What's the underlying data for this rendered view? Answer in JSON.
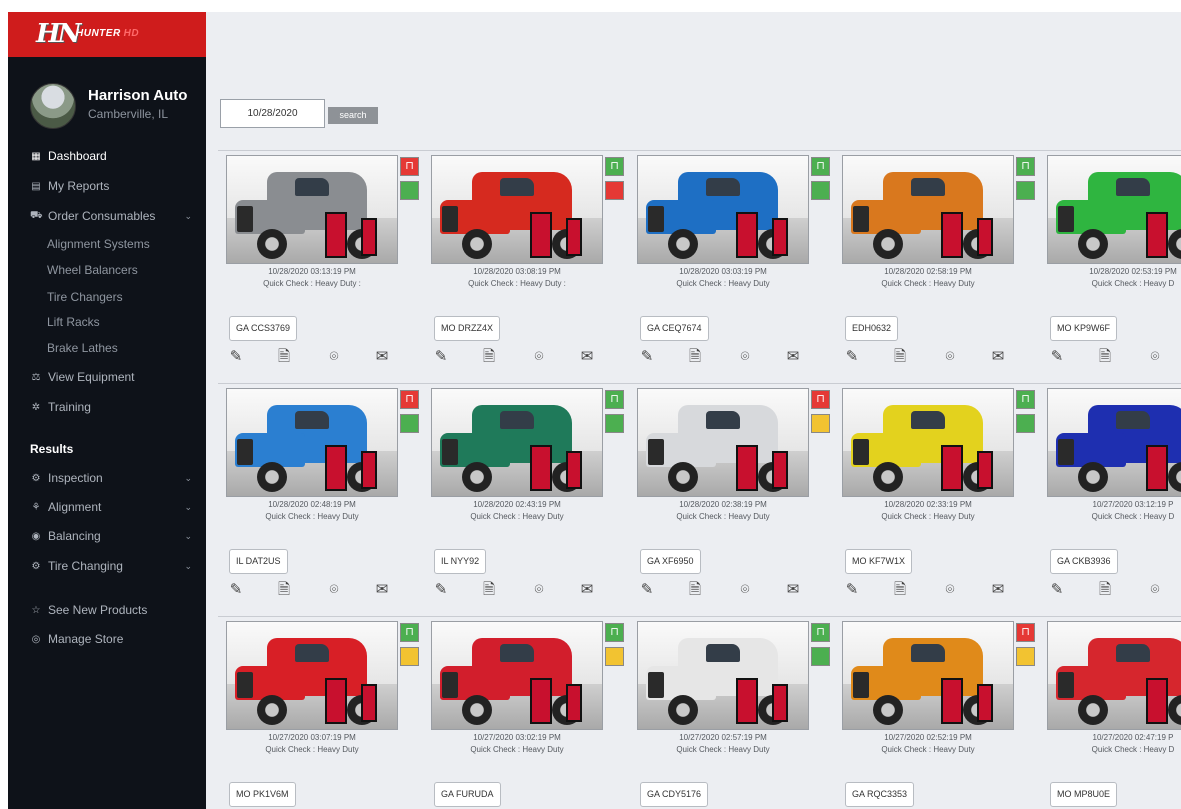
{
  "brand": {
    "logo_mark": "HN",
    "logo_word": "HUNTER",
    "logo_word2": "HD"
  },
  "profile": {
    "name": "Harrison Auto",
    "location": "Camberville, IL"
  },
  "nav": {
    "dashboard": "Dashboard",
    "my_reports": "My Reports",
    "order_consumables": "Order Consumables",
    "alignment_systems": "Alignment Systems",
    "wheel_balancers": "Wheel Balancers",
    "tire_changers": "Tire Changers",
    "lift_racks": "Lift Racks",
    "brake_lathes": "Brake Lathes",
    "view_equipment": "View Equipment",
    "training": "Training",
    "results_heading": "Results",
    "inspection": "Inspection",
    "alignment": "Alignment",
    "balancing": "Balancing",
    "tire_changing": "Tire Changing",
    "see_new_products": "See New Products",
    "manage_store": "Manage Store"
  },
  "search": {
    "date_value": "10/28/2020",
    "button_label": "search"
  },
  "cards": [
    {
      "timestamp": "10/28/2020 03:13:19 PM",
      "check": "Quick Check : Heavy Duty :",
      "plate": "GA CCS3769",
      "color": "#8a8d91",
      "badges": [
        "red",
        "green"
      ]
    },
    {
      "timestamp": "10/28/2020 03:08:19 PM",
      "check": "Quick Check : Heavy Duty :",
      "plate": "MO DRZZ4X",
      "color": "#d62a1f",
      "badges": [
        "green",
        "red"
      ]
    },
    {
      "timestamp": "10/28/2020 03:03:19 PM",
      "check": "Quick Check : Heavy Duty",
      "plate": "GA CEQ7674",
      "color": "#1e6fc4",
      "badges": [
        "green",
        "green"
      ]
    },
    {
      "timestamp": "10/28/2020 02:58:19 PM",
      "check": "Quick Check : Heavy Duty",
      "plate": "EDH0632",
      "color": "#d9781e",
      "badges": [
        "green",
        "green"
      ]
    },
    {
      "timestamp": "10/28/2020 02:53:19 PM",
      "check": "Quick Check : Heavy D",
      "plate": "MO KP9W6F",
      "color": "#2fb540",
      "badges": [],
      "partial": true
    },
    {
      "timestamp": "10/28/2020 02:48:19 PM",
      "check": "Quick Check : Heavy Duty",
      "plate": "IL DAT2US",
      "color": "#2b7fd1",
      "badges": [
        "red",
        "green"
      ]
    },
    {
      "timestamp": "10/28/2020 02:43:19 PM",
      "check": "Quick Check : Heavy Duty",
      "plate": "IL NYY92",
      "color": "#1f7a5a",
      "badges": [
        "green",
        "green"
      ]
    },
    {
      "timestamp": "10/28/2020 02:38:19 PM",
      "check": "Quick Check : Heavy Duty",
      "plate": "GA XF6950",
      "color": "#d7d9dc",
      "badges": [
        "red",
        "yellow"
      ]
    },
    {
      "timestamp": "10/28/2020 02:33:19 PM",
      "check": "Quick Check : Heavy Duty",
      "plate": "MO KF7W1X",
      "color": "#e3d21e",
      "badges": [
        "green",
        "green"
      ]
    },
    {
      "timestamp": "10/27/2020 03:12:19 P",
      "check": "Quick Check : Heavy D",
      "plate": "GA CKB3936",
      "color": "#1e2fb0",
      "badges": [],
      "partial": true
    },
    {
      "timestamp": "10/27/2020 03:07:19 PM",
      "check": "Quick Check : Heavy Duty",
      "plate": "MO PK1V6M",
      "color": "#d81f26",
      "badges": [
        "green",
        "yellow"
      ]
    },
    {
      "timestamp": "10/27/2020 03:02:19 PM",
      "check": "Quick Check : Heavy Duty",
      "plate": "GA FURUDA",
      "color": "#d21e2c",
      "badges": [
        "green",
        "yellow"
      ]
    },
    {
      "timestamp": "10/27/2020 02:57:19 PM",
      "check": "Quick Check : Heavy Duty",
      "plate": "GA CDY5176",
      "color": "#e6e6e6",
      "badges": [
        "green",
        "green"
      ]
    },
    {
      "timestamp": "10/27/2020 02:52:19 PM",
      "check": "Quick Check : Heavy Duty",
      "plate": "GA RQC3353",
      "color": "#e08a1a",
      "badges": [
        "red",
        "yellow"
      ]
    },
    {
      "timestamp": "10/27/2020 02:47:19 P",
      "check": "Quick Check : Heavy D",
      "plate": "MO MP8U0E",
      "color": "#d6262d",
      "badges": [],
      "partial": true
    }
  ],
  "icons": {
    "edit": "pencil-icon",
    "report": "document-icon",
    "photo": "camera-icon",
    "email": "envelope-icon",
    "lift": "lift-icon",
    "status": "status-block-icon"
  }
}
